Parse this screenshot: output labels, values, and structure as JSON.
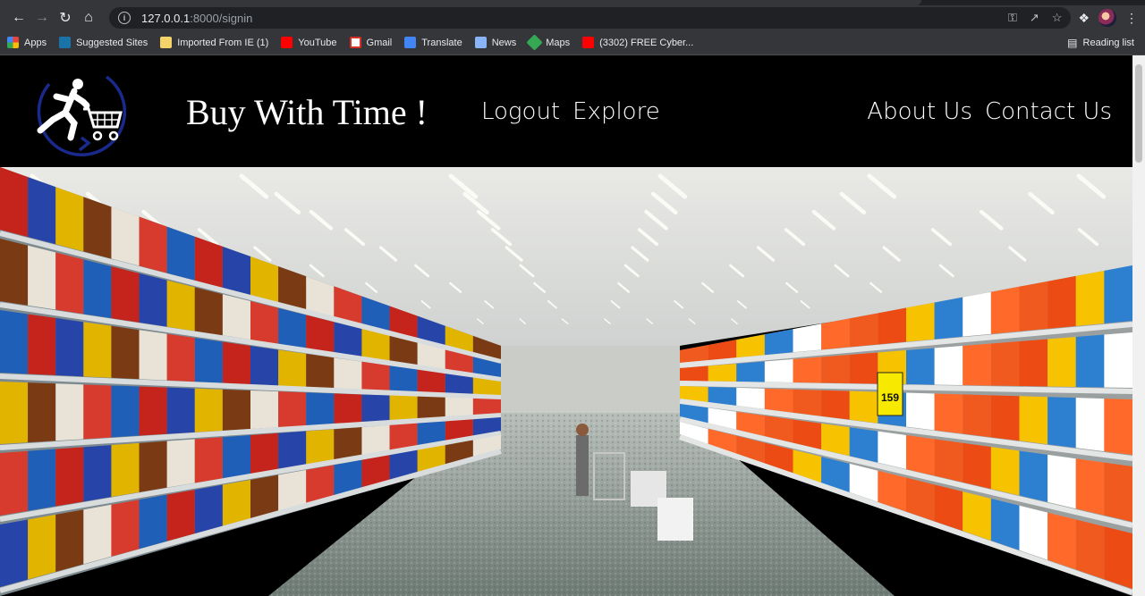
{
  "browser": {
    "url_host": "127.0.0.1",
    "url_path": ":8000/signin",
    "bookmarks": [
      {
        "label": "Apps",
        "icon": "apps-icon"
      },
      {
        "label": "Suggested Sites",
        "icon": "bing-icon"
      },
      {
        "label": "Imported From IE (1)",
        "icon": "folder-icon"
      },
      {
        "label": "YouTube",
        "icon": "youtube-icon"
      },
      {
        "label": "Gmail",
        "icon": "gmail-icon"
      },
      {
        "label": "Translate",
        "icon": "translate-icon"
      },
      {
        "label": "News",
        "icon": "news-icon"
      },
      {
        "label": "Maps",
        "icon": "maps-icon"
      },
      {
        "label": "(3302) FREE Cyber...",
        "icon": "youtube-icon"
      }
    ],
    "reading_list": "Reading list"
  },
  "site": {
    "brand": "Buy With Time !",
    "nav_left": [
      "Logout",
      "Explore"
    ],
    "nav_right": [
      "About Us",
      "Contact Us"
    ],
    "accent": "#1a2a8c"
  },
  "hero": {
    "price_tag": "159"
  }
}
